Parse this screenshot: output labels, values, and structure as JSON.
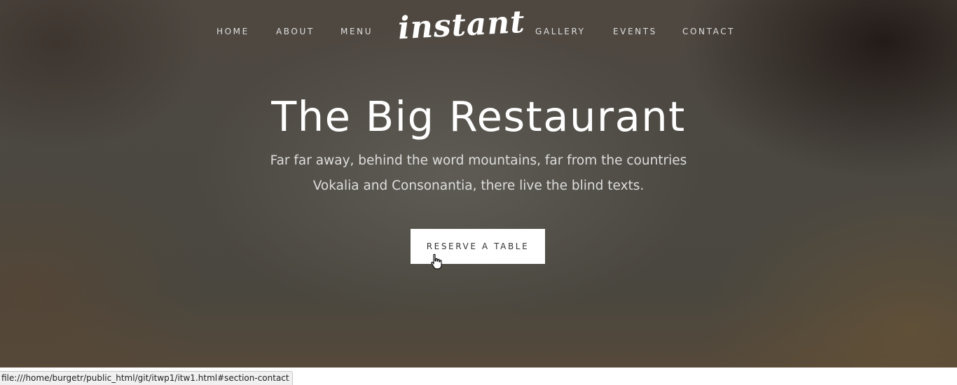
{
  "nav": {
    "items": [
      {
        "label": "HOME"
      },
      {
        "label": "ABOUT"
      },
      {
        "label": "MENU"
      },
      {
        "label": "GALLERY"
      },
      {
        "label": "EVENTS"
      },
      {
        "label": "CONTACT"
      }
    ],
    "logo_text": "instant"
  },
  "hero": {
    "title": "The Big Restaurant",
    "subtitle": "Far far away, behind the word mountains, far from the countries Vokalia and Consonantia, there live the blind texts.",
    "button_label": "RESERVE A TABLE"
  },
  "status_bar": {
    "url": "file:///home/burgetr/public_html/git/itwp1/itw1.html#section-contact"
  },
  "icons": {
    "cursor": "hand-pointer-icon"
  },
  "colors": {
    "background_tint": "#4b4842",
    "text": "#ffffff",
    "button_bg": "#ffffff",
    "button_text": "#333333",
    "status_bar_bg": "#f0f0f0"
  }
}
